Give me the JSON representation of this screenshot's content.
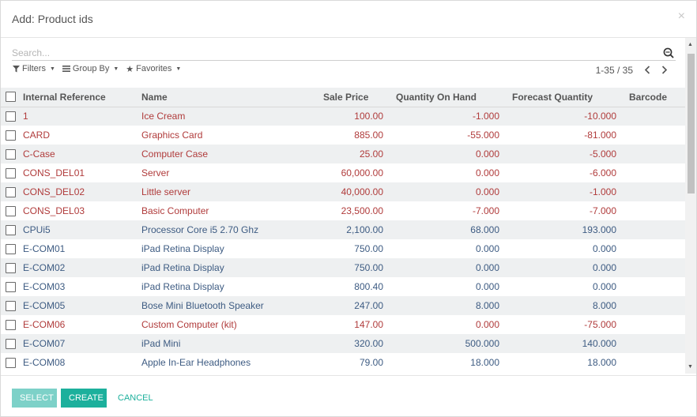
{
  "dialog": {
    "title": "Add: Product ids",
    "close_glyph": "×"
  },
  "search": {
    "placeholder": "Search...",
    "value": ""
  },
  "options": {
    "filters": "Filters",
    "group_by": "Group By",
    "favorites": "Favorites"
  },
  "pager": {
    "text": "1-35 / 35"
  },
  "table": {
    "headers": {
      "ref": "Internal Reference",
      "name": "Name",
      "price": "Sale Price",
      "qty": "Quantity On Hand",
      "forecast": "Forecast Quantity",
      "barcode": "Barcode"
    },
    "rows": [
      {
        "ref": "1",
        "name": "Ice Cream",
        "price": "100.00",
        "qty": "-1.000",
        "forecast": "-10.000",
        "barcode": "",
        "color": "red"
      },
      {
        "ref": "CARD",
        "name": "Graphics Card",
        "price": "885.00",
        "qty": "-55.000",
        "forecast": "-81.000",
        "barcode": "",
        "color": "red"
      },
      {
        "ref": "C-Case",
        "name": "Computer Case",
        "price": "25.00",
        "qty": "0.000",
        "forecast": "-5.000",
        "barcode": "",
        "color": "red"
      },
      {
        "ref": "CONS_DEL01",
        "name": "Server",
        "price": "60,000.00",
        "qty": "0.000",
        "forecast": "-6.000",
        "barcode": "",
        "color": "red"
      },
      {
        "ref": "CONS_DEL02",
        "name": "Little server",
        "price": "40,000.00",
        "qty": "0.000",
        "forecast": "-1.000",
        "barcode": "",
        "color": "red"
      },
      {
        "ref": "CONS_DEL03",
        "name": "Basic Computer",
        "price": "23,500.00",
        "qty": "-7.000",
        "forecast": "-7.000",
        "barcode": "",
        "color": "red"
      },
      {
        "ref": "CPUi5",
        "name": "Processor Core i5 2.70 Ghz",
        "price": "2,100.00",
        "qty": "68.000",
        "forecast": "193.000",
        "barcode": "",
        "color": "blue"
      },
      {
        "ref": "E-COM01",
        "name": "iPad Retina Display",
        "price": "750.00",
        "qty": "0.000",
        "forecast": "0.000",
        "barcode": "",
        "color": "blue"
      },
      {
        "ref": "E-COM02",
        "name": "iPad Retina Display",
        "price": "750.00",
        "qty": "0.000",
        "forecast": "0.000",
        "barcode": "",
        "color": "blue"
      },
      {
        "ref": "E-COM03",
        "name": "iPad Retina Display",
        "price": "800.40",
        "qty": "0.000",
        "forecast": "0.000",
        "barcode": "",
        "color": "blue"
      },
      {
        "ref": "E-COM05",
        "name": "Bose Mini Bluetooth Speaker",
        "price": "247.00",
        "qty": "8.000",
        "forecast": "8.000",
        "barcode": "",
        "color": "blue"
      },
      {
        "ref": "E-COM06",
        "name": "Custom Computer (kit)",
        "price": "147.00",
        "qty": "0.000",
        "forecast": "-75.000",
        "barcode": "",
        "color": "red"
      },
      {
        "ref": "E-COM07",
        "name": "iPad Mini",
        "price": "320.00",
        "qty": "500.000",
        "forecast": "140.000",
        "barcode": "",
        "color": "blue"
      },
      {
        "ref": "E-COM08",
        "name": "Apple In-Ear Headphones",
        "price": "79.00",
        "qty": "18.000",
        "forecast": "18.000",
        "barcode": "",
        "color": "blue"
      }
    ]
  },
  "footer": {
    "select": "SELECT",
    "create": "CREATE",
    "cancel": "CANCEL"
  },
  "colors": {
    "accent": "#1cb09c",
    "accent_disabled": "#7dd1c8",
    "negative_row": "#b03b3b",
    "normal_row": "#3d5b82",
    "stripe": "#eef0f1"
  },
  "icons": {
    "search": "search-icon",
    "filter": "filter-icon",
    "group": "list-icon",
    "favorite": "star-icon",
    "prev": "chevron-left-icon",
    "next": "chevron-right-icon",
    "close": "close-icon"
  }
}
